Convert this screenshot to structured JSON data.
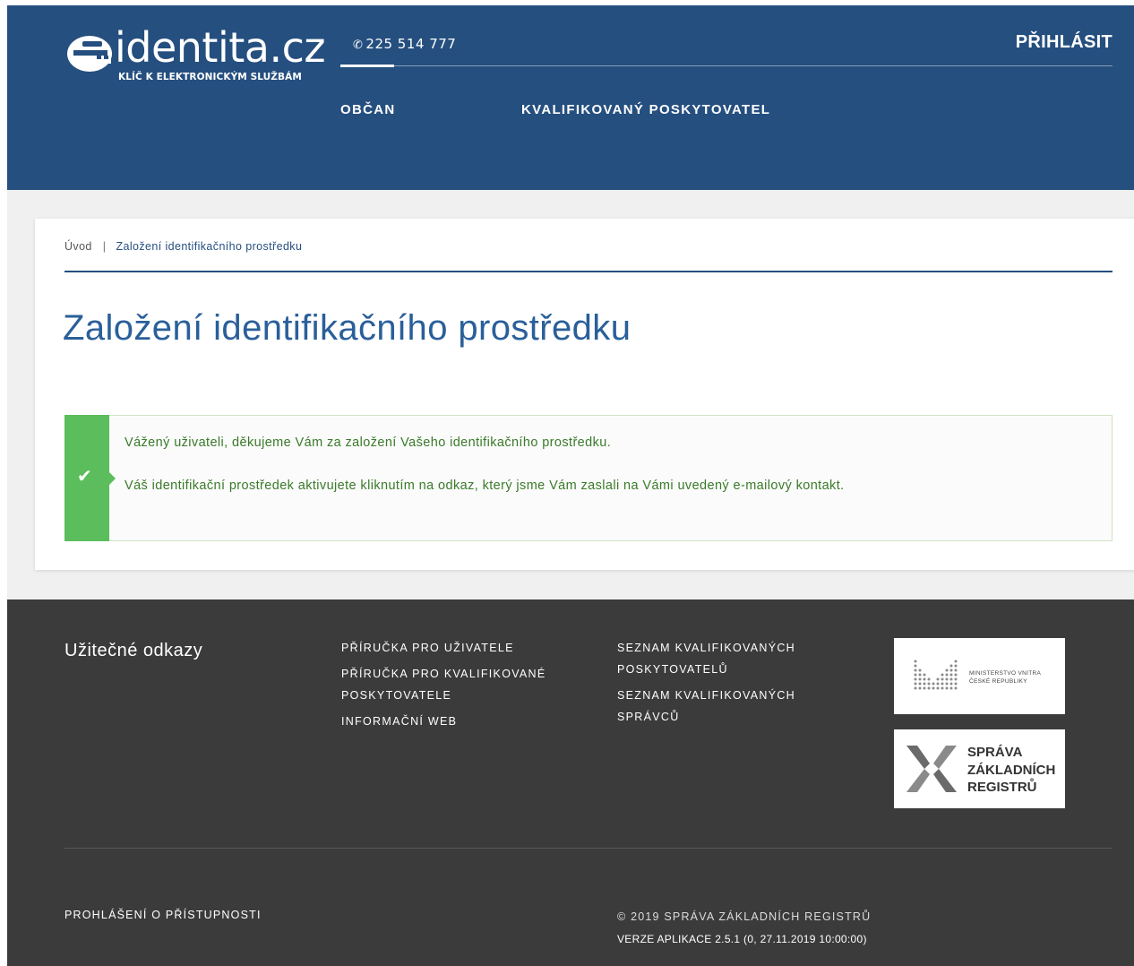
{
  "header": {
    "logo_word": "identita.cz",
    "logo_tagline": "KLÍČ K ELEKTRONICKÝM SLUŽBÁM",
    "phone": "225 514 777",
    "login_label": "PŘIHLÁSIT",
    "nav": [
      {
        "label": "OBČAN"
      },
      {
        "label": "KVALIFIKOVANÝ POSKYTOVATEL"
      }
    ],
    "colors": {
      "header_bg": "#254f7f"
    }
  },
  "breadcrumb": {
    "home": "Úvod",
    "separator": "|",
    "current": "Založení identifikačního prostředku"
  },
  "page_title": "Založení identifikačního prostředku",
  "alert": {
    "type": "success",
    "icon": "check-icon",
    "line1": "Vážený uživateli, děkujeme Vám za založení Vašeho identifikačního prostředku.",
    "line2": "Váš identifikační prostředek aktivujete kliknutím na odkaz, který jsme Vám zaslali na Vámi uvedený e-mailový kontakt.",
    "colors": {
      "stripe": "#5cbd5c",
      "text": "#3a7a2a"
    }
  },
  "footer": {
    "useful_links_title": "Užitečné odkazy",
    "links_col1": [
      "PŘÍRUČKA PRO UŽIVATELE",
      "PŘÍRUČKA PRO KVALIFIKOVANÉ POSKYTOVATELE",
      "INFORMAČNÍ WEB"
    ],
    "links_col2": [
      "SEZNAM KVALIFIKOVANÝCH POSKYTOVATELŮ",
      "SEZNAM KVALIFIKOVANÝCH SPRÁVCŮ"
    ],
    "partner_mvcr": {
      "line1": "MINISTERSTVO VNITRA",
      "line2": "ČESKÉ REPUBLIKY"
    },
    "partner_szr": {
      "line1": "SPRÁVA",
      "line2": "ZÁKLADNÍCH",
      "line3": "REGISTRŮ"
    },
    "accessibility": "PROHLÁŠENÍ O PŘÍSTUPNOSTI",
    "copyright": "© 2019 SPRÁVA ZÁKLADNÍCH REGISTRŮ",
    "version": "VERZE APLIKACE 2.5.1 (0, 27.11.2019 10:00:00)",
    "colors": {
      "footer_bg": "#3b3b3b"
    }
  }
}
